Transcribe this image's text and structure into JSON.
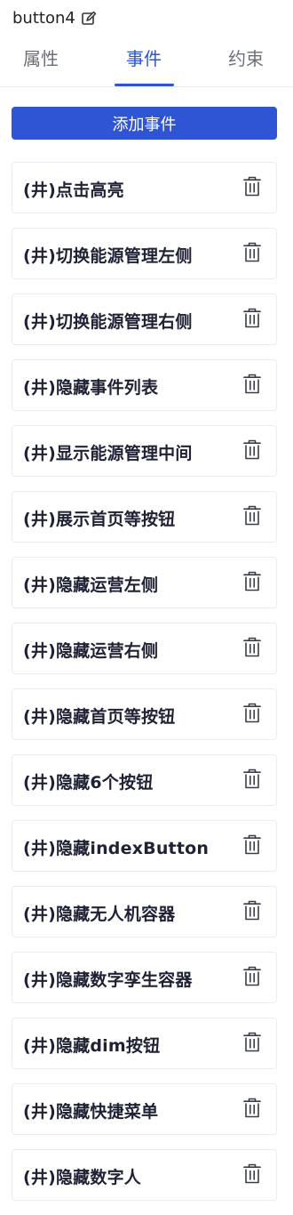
{
  "header": {
    "title": "button4",
    "edit_icon": "edit-icon"
  },
  "tabs": [
    {
      "label": "属性",
      "active": false
    },
    {
      "label": "事件",
      "active": true
    },
    {
      "label": "约束",
      "active": false
    }
  ],
  "colors": {
    "accent": "#2f55d4",
    "text": "#1f2235",
    "muted_tab": "#6b6f7a",
    "border": "#ececf1"
  },
  "actions": {
    "add_event_label": "添加事件"
  },
  "events": [
    {
      "label": "(井)点击高亮"
    },
    {
      "label": "(井)切换能源管理左侧"
    },
    {
      "label": "(井)切换能源管理右侧"
    },
    {
      "label": "(井)隐藏事件列表"
    },
    {
      "label": "(井)显示能源管理中间"
    },
    {
      "label": "(井)展示首页等按钮"
    },
    {
      "label": "(井)隐藏运营左侧"
    },
    {
      "label": "(井)隐藏运营右侧"
    },
    {
      "label": "(井)隐藏首页等按钮"
    },
    {
      "label": "(井)隐藏6个按钮"
    },
    {
      "label": "(井)隐藏indexButton"
    },
    {
      "label": "(井)隐藏无人机容器"
    },
    {
      "label": "(井)隐藏数字孪生容器"
    },
    {
      "label": "(井)隐藏dim按钮"
    },
    {
      "label": "(井)隐藏快捷菜单"
    },
    {
      "label": "(井)隐藏数字人"
    }
  ],
  "icons": {
    "delete": "trash-icon"
  }
}
